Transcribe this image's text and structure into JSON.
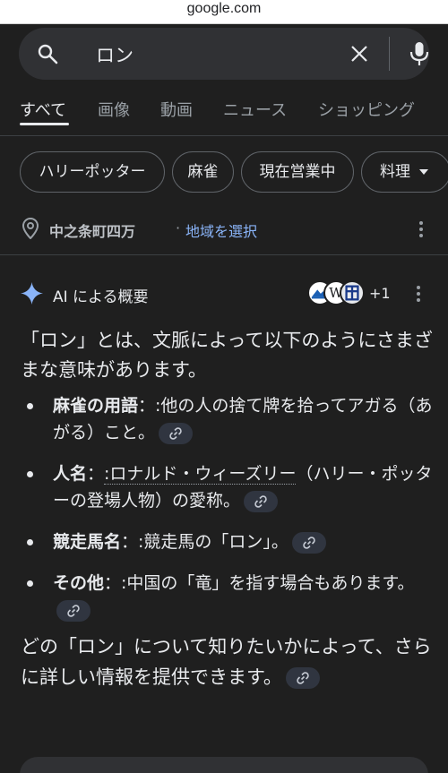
{
  "browser": {
    "url": "google.com"
  },
  "search": {
    "query": "ロン"
  },
  "tabs": [
    "すべて",
    "画像",
    "動画",
    "ニュース",
    "ショッピング"
  ],
  "chips": [
    "ハリーポッター",
    "麻雀",
    "現在営業中",
    "料理"
  ],
  "location": {
    "place": "中之条町四万",
    "separator": "·",
    "select_label": "地域を選択"
  },
  "ai_overview": {
    "title": "AI による概要",
    "source_count": "+1",
    "intro": "「ロン」とは、文脈によって以下のようにさまざまな意味があります。",
    "items": [
      {
        "term": "麻雀の用語",
        "sep": "：",
        "text": ":他の人の捨て牌を拾ってアガる（あがる）こと。"
      },
      {
        "term": "人名",
        "sep": "：",
        "text_link": ":ロナルド・ウィーズリー",
        "text_rest": "（ハリー・ポッターの登場人物）の愛称。"
      },
      {
        "term": "競走馬名",
        "sep": "：",
        "text": ":競走馬の「ロン」。"
      },
      {
        "term": "その他",
        "sep": "：",
        "text": ":中国の「竜」を指す場合もあります。"
      }
    ],
    "closing": "どの「ロン」について知りたいかによって、さらに詳しい情報を提供できます。"
  },
  "colors": {
    "background": "#1f1f1f",
    "link": "#8ab4f8",
    "searchbox": "#303134"
  },
  "icons": [
    "search-icon",
    "clear-icon",
    "mic-icon",
    "location-pin-icon",
    "more-vert-icon",
    "sparkle-icon",
    "link-icon"
  ]
}
